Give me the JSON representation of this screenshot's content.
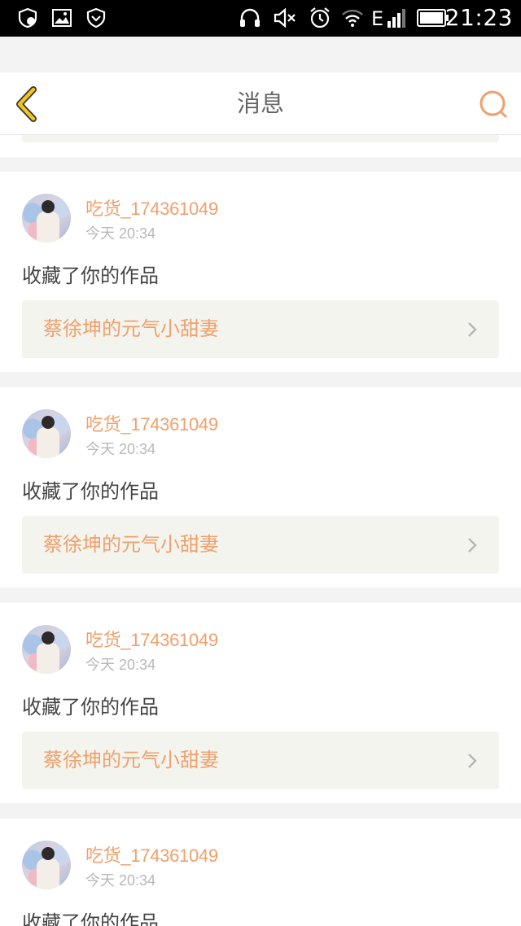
{
  "status_bar": {
    "time": "21:23",
    "icons": [
      "shield-notification-icon",
      "image-icon",
      "vpn-shield-icon",
      "headphones-icon",
      "mute-icon",
      "alarm-icon",
      "wifi-icon",
      "signal-e-icon",
      "battery-icon"
    ]
  },
  "header": {
    "title": "消息",
    "back_icon": "chevron-left-icon",
    "search_icon": "search-icon"
  },
  "colors": {
    "accent_orange": "#f0a06c",
    "back_icon_yellow": "#f2c51a",
    "card_link_bg": "#f4f4ee",
    "page_bg": "#f3f3f3"
  },
  "messages": [
    {
      "username": "吃货_174361049",
      "time": "今天 20:34",
      "action": "收藏了你的作品",
      "work_title": "蔡徐坤的元气小甜妻"
    },
    {
      "username": "吃货_174361049",
      "time": "今天 20:34",
      "action": "收藏了你的作品",
      "work_title": "蔡徐坤的元气小甜妻"
    },
    {
      "username": "吃货_174361049",
      "time": "今天 20:34",
      "action": "收藏了你的作品",
      "work_title": "蔡徐坤的元气小甜妻"
    },
    {
      "username": "吃货_174361049",
      "time": "今天 20:34",
      "action": "收藏了你的作品"
    }
  ]
}
